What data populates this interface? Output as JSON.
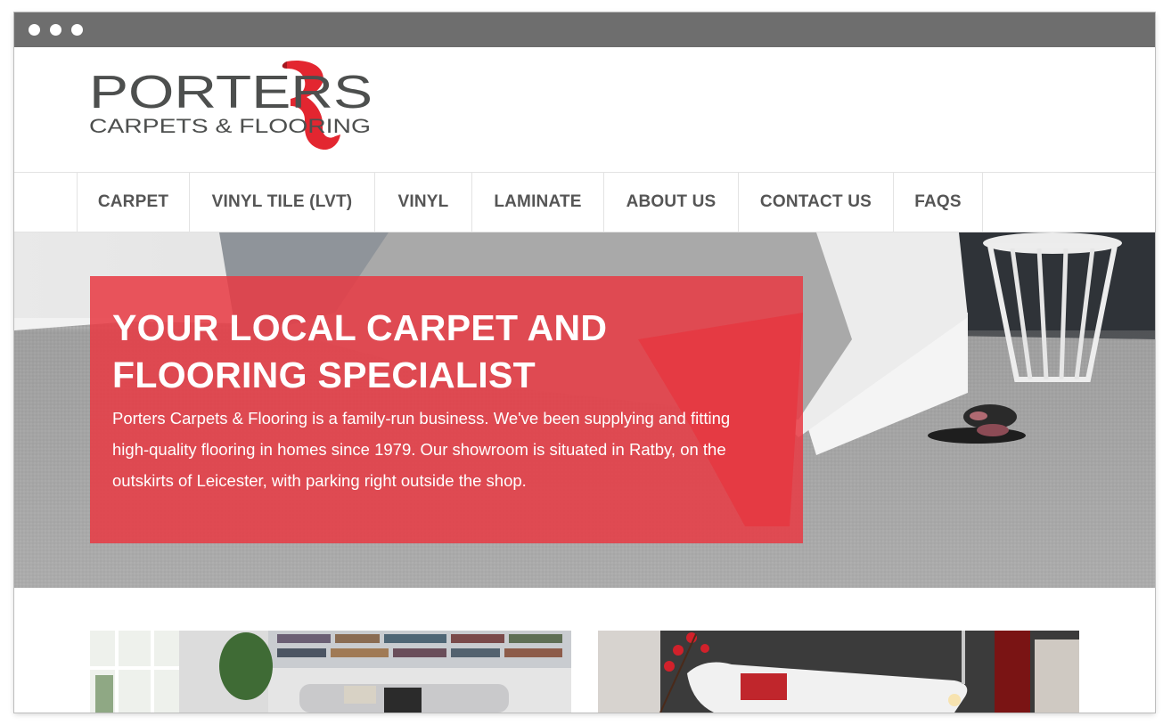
{
  "window": {
    "controls": [
      "close-dot",
      "minimize-dot",
      "maximize-dot"
    ]
  },
  "logo": {
    "name": "PORTERS",
    "tagline": "CARPETS & FLOORING",
    "brand_color": "#e32630",
    "text_color": "#4d4f4e"
  },
  "nav": {
    "items": [
      {
        "label": "CARPET"
      },
      {
        "label": "VINYL TILE (LVT)"
      },
      {
        "label": "VINYL"
      },
      {
        "label": "LAMINATE"
      },
      {
        "label": "ABOUT US"
      },
      {
        "label": "CONTACT US"
      },
      {
        "label": "FAQS"
      }
    ]
  },
  "hero": {
    "title_line1": "YOUR LOCAL CARPET AND",
    "title_line2": "FLOORING SPECIALIST",
    "text": "Porters Carpets & Flooring is a family-run business. We've been supplying and fitting high-quality flooring in homes since 1979. Our showroom is situated in Ratby, on the outskirts of Leicester, with parking right outside the shop.",
    "overlay_color": "#e83a44",
    "image": "bedroom-carpet-photo"
  },
  "cards": [
    {
      "image": "living-room-photo"
    },
    {
      "image": "bathroom-photo"
    }
  ]
}
